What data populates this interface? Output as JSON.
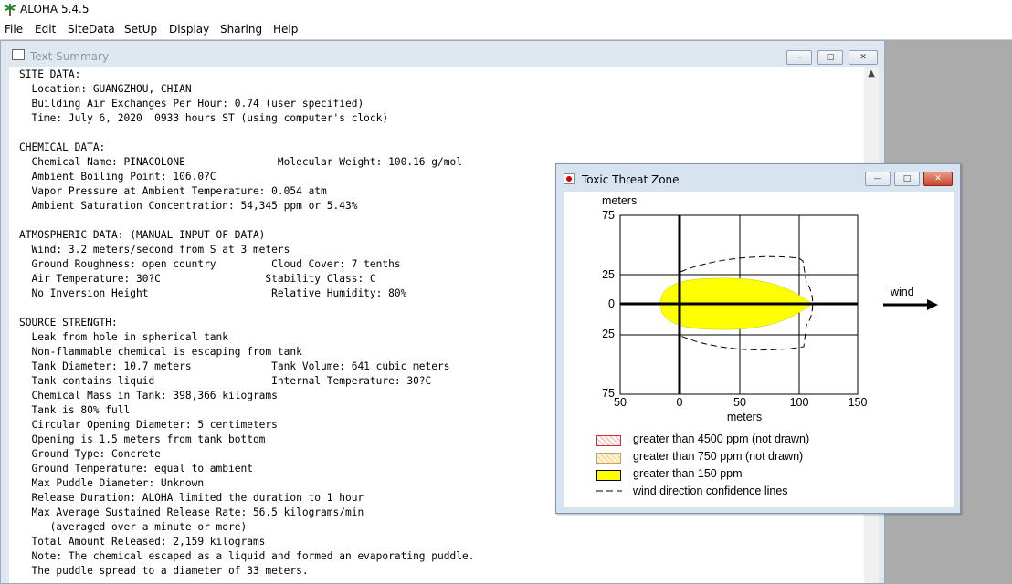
{
  "app": {
    "title": "ALOHA 5.4.5"
  },
  "menu": [
    "File",
    "Edit",
    "SiteData",
    "SetUp",
    "Display",
    "Sharing",
    "Help"
  ],
  "text_summary": {
    "title": "Text Summary",
    "lines": [
      "SITE DATA:",
      "  Location: GUANGZHOU, CHIAN",
      "  Building Air Exchanges Per Hour: 0.74 (user specified)",
      "  Time: July 6, 2020  0933 hours ST (using computer's clock)",
      "",
      "CHEMICAL DATA:",
      "  Chemical Name: PINACOLONE               Molecular Weight: 100.16 g/mol",
      "  Ambient Boiling Point: 106.0?C",
      "  Vapor Pressure at Ambient Temperature: 0.054 atm",
      "  Ambient Saturation Concentration: 54,345 ppm or 5.43%",
      "",
      "ATMOSPHERIC DATA: (MANUAL INPUT OF DATA)",
      "  Wind: 3.2 meters/second from S at 3 meters",
      "  Ground Roughness: open country         Cloud Cover: 7 tenths",
      "  Air Temperature: 30?C                 Stability Class: C",
      "  No Inversion Height                    Relative Humidity: 80%",
      "",
      "SOURCE STRENGTH:",
      "  Leak from hole in spherical tank",
      "  Non-flammable chemical is escaping from tank",
      "  Tank Diameter: 10.7 meters             Tank Volume: 641 cubic meters",
      "  Tank contains liquid                   Internal Temperature: 30?C",
      "  Chemical Mass in Tank: 398,366 kilograms",
      "  Tank is 80% full",
      "  Circular Opening Diameter: 5 centimeters",
      "  Opening is 1.5 meters from tank bottom",
      "  Ground Type: Concrete",
      "  Ground Temperature: equal to ambient",
      "  Max Puddle Diameter: Unknown",
      "  Release Duration: ALOHA limited the duration to 1 hour",
      "  Max Average Sustained Release Rate: 56.5 kilograms/min",
      "     (averaged over a minute or more)",
      "  Total Amount Released: 2,159 kilograms",
      "  Note: The chemical escaped as a liquid and formed an evaporating puddle.",
      "  The puddle spread to a diameter of 33 meters."
    ]
  },
  "threat_zone": {
    "title": "Toxic Threat Zone",
    "y_unit": "meters",
    "x_unit": "meters",
    "y_ticks": [
      "75",
      "25",
      "0",
      "25",
      "75"
    ],
    "x_ticks": [
      "50",
      "0",
      "50",
      "100",
      "150"
    ],
    "wind_label": "wind",
    "legend": [
      {
        "label": "greater than 4500 ppm (not drawn)",
        "color": "#f4c8c8"
      },
      {
        "label": "greater than 750 ppm (not drawn)",
        "color": "#f5dfa8"
      },
      {
        "label": "greater than 150 ppm",
        "color": "#ffff00"
      },
      {
        "label": "wind direction confidence lines",
        "color": "#000000"
      }
    ]
  }
}
